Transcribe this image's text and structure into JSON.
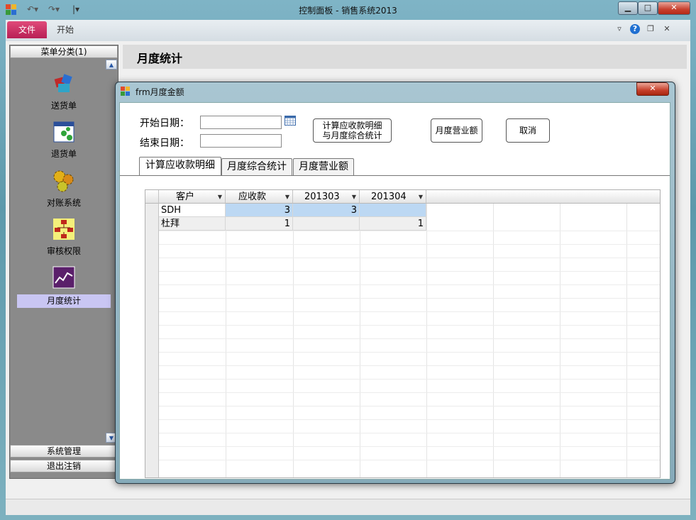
{
  "window": {
    "title": "控制面板 - 销售系统2013",
    "min": "▁",
    "max": "□",
    "close": "✕"
  },
  "ribbon": {
    "file_tab": "文件",
    "start_tab": "开始",
    "chevron": "▿",
    "help": "?",
    "restore": "❐",
    "close": "✕"
  },
  "nav": {
    "header": "菜单分类(1)",
    "items": [
      {
        "label": "送货单",
        "icon": "delivery-icon"
      },
      {
        "label": "退货单",
        "icon": "return-icon"
      },
      {
        "label": "对账系统",
        "icon": "gears-icon"
      },
      {
        "label": "审核权限",
        "icon": "org-chart-icon"
      },
      {
        "label": "月度统计",
        "icon": "chart-icon"
      }
    ],
    "footer": [
      "系统管理",
      "退出注销"
    ]
  },
  "main": {
    "title": "月度统计"
  },
  "dialog": {
    "title": "frm月度金额",
    "close": "✕",
    "start_label": "开始日期：",
    "end_label": "结束日期：",
    "btn_calc_line1": "计算应收款明细",
    "btn_calc_line2": "与月度综合统计",
    "btn_monthly": "月度营业额",
    "btn_cancel": "取消",
    "tabs": [
      "计算应收款明细",
      "月度综合统计",
      "月度营业额"
    ],
    "grid": {
      "columns": [
        "客户",
        "应收款",
        "201303",
        "201304"
      ],
      "rows": [
        [
          "SDH",
          "3",
          "3",
          ""
        ],
        [
          "杜拜",
          "1",
          "",
          "1"
        ]
      ]
    }
  }
}
